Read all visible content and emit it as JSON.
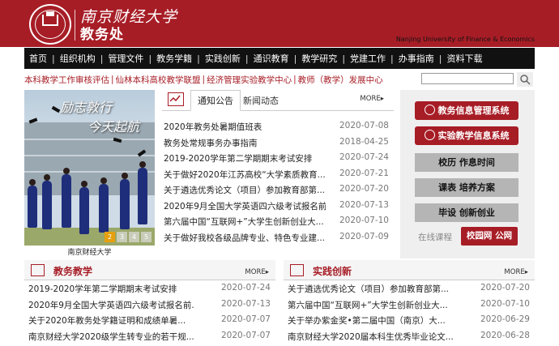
{
  "header": {
    "university_name": "南京财经大学",
    "department_name": "教务处",
    "university_name_en": "Nanjing University of Finance & Economics"
  },
  "nav": {
    "items": [
      "首页",
      "组织机构",
      "管理文件",
      "教务学籍",
      "实践创新",
      "通识教育",
      "教学研究",
      "党建工作",
      "办事指南",
      "资料下载"
    ]
  },
  "quicklinks": {
    "items": [
      "本科教学工作审核评估",
      "仙林本科高校教学联盟",
      "经济管理实验教学中心",
      "教师（教学）发展中心"
    ]
  },
  "search": {
    "placeholder": ""
  },
  "banner": {
    "slogan_1": "励志敦行",
    "slogan_2": "今天起航",
    "caption": "南京财经大学",
    "pager": [
      "2",
      "3",
      "4",
      "5"
    ]
  },
  "news": {
    "tabs": [
      "通知公告",
      "新闻动态"
    ],
    "more_label": "MORE▸",
    "items": [
      {
        "title": "2020年教务处暑期值班表",
        "date": "2020-07-08"
      },
      {
        "title": "教务处常规事务办事指南",
        "date": "2018-04-25"
      },
      {
        "title": "2019-2020学年第二学期期末考试安排",
        "date": "2020-07-24"
      },
      {
        "title": "关于做好2020年江苏高校“大学素质教育...",
        "date": "2020-07-21"
      },
      {
        "title": "关于遴选优秀论文（项目）参加教育部第...",
        "date": "2020-07-20"
      },
      {
        "title": "2020年9月全国大学英语四六级考试报名前...",
        "date": "2020-07-13"
      },
      {
        "title": "第六届中国“互联网+”大学生创新创业大...",
        "date": "2020-07-10"
      },
      {
        "title": "关于做好我校各级品牌专业、特色专业建...",
        "date": "2020-07-09"
      }
    ]
  },
  "side": {
    "system_buttons": [
      "教务信息管理系统",
      "实验教学信息系统"
    ],
    "link_buttons": [
      "校历 作息时间",
      "课表 培养方案",
      "毕设 创新创业"
    ],
    "online_course": "在线课程",
    "campus_network": "校园网 公网"
  },
  "teaching": {
    "title": "教务教学",
    "more_label": "MORE▸",
    "items": [
      {
        "title": "2019-2020学年第二学期期末考试安排",
        "date": "2020-07-24"
      },
      {
        "title": "2020年9月全国大学英语四六级考试报名前...",
        "date": "2020-07-13"
      },
      {
        "title": "关于2020年教务处学籍证明和成绩单暑...",
        "date": "2020-07-07"
      },
      {
        "title": "南京财经大学2020级学生转专业的若干规...",
        "date": "2020-07-07"
      }
    ]
  },
  "practice": {
    "title": "实践创新",
    "more_label": "MORE▸",
    "items": [
      {
        "title": "关于遴选优秀论文（项目）参加教育部第...",
        "date": "2020-07-20"
      },
      {
        "title": "第六届中国“互联网+”大学生创新创业大...",
        "date": "2020-07-10"
      },
      {
        "title": "关于举办紫金奖•第二届中国（南京）大...",
        "date": "2020-06-29"
      },
      {
        "title": "南京财经大学2020届本科生优秀毕业论文...",
        "date": "2020-06-28"
      }
    ]
  },
  "colors": {
    "brand_red": "#a71d26",
    "nav_black": "#111111"
  }
}
